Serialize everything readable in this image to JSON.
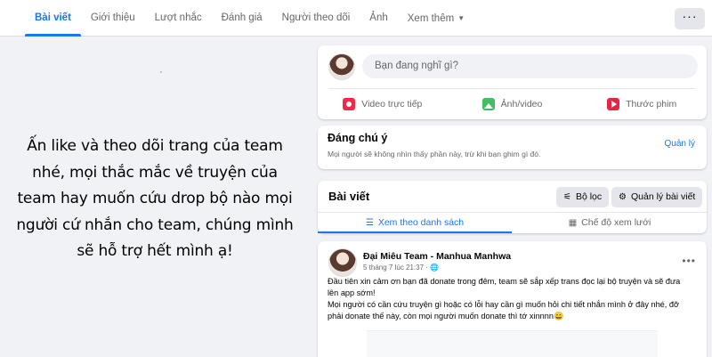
{
  "tabs": [
    {
      "label": "Bài viết",
      "active": true
    },
    {
      "label": "Giới thiệu"
    },
    {
      "label": "Lượt nhắc"
    },
    {
      "label": "Đánh giá"
    },
    {
      "label": "Người theo dõi"
    },
    {
      "label": "Ảnh"
    },
    {
      "label": "Xem thêm"
    }
  ],
  "more_button": "···",
  "left_banner": {
    "lines": [
      "Ấn like và theo dõi trang của team",
      "nhé, mọi thắc mắc về truyện của",
      "team hay muốn cứu drop bộ nào mọi",
      "người cứ nhắn cho team, chúng mình",
      "sẽ hỗ trợ hết mình ạ!"
    ]
  },
  "compose": {
    "placeholder": "Bạn đang nghĩ gì?",
    "actions": [
      {
        "label": "Video trực tiếp",
        "icon": "live-video-icon"
      },
      {
        "label": "Ảnh/video",
        "icon": "photo-icon"
      },
      {
        "label": "Thước phim",
        "icon": "reel-icon"
      }
    ]
  },
  "notice": {
    "title": "Đáng chú ý",
    "subtitle": "Mọi người sẽ không nhìn thấy phần này, trừ khi bạn ghim gì đó.",
    "manage_label": "Quản lý"
  },
  "posts_header": {
    "title": "Bài viết",
    "filter_label": "Bộ lọc",
    "manage_posts_label": "Quản lý bài viết",
    "list_view_label": "Xem theo danh sách",
    "grid_view_label": "Chế độ xem lưới"
  },
  "post": {
    "author": "Đại Miêu Team - Manhua Manhwa",
    "meta": "5 tháng 7 lúc 21:37 · ",
    "lines": [
      "Đầu tiên xin cảm ơn bạn đã donate trong đêm, team sẽ sắp xếp trans đọc lại bộ truyện và sẽ đưa",
      "lên app sớm!",
      "Mọi người có cần cứu truyện gì hoặc có lỗi hay cần gì muốn hỏi chi tiết nhắn mình ở đây nhé, đỡ",
      "phải donate thế này, còn mọi người muốn donate thì tớ xinnnn😄"
    ]
  },
  "colors": {
    "accent": "#1877f2",
    "background": "#f0f2f5",
    "secondary_text": "#65676b"
  }
}
